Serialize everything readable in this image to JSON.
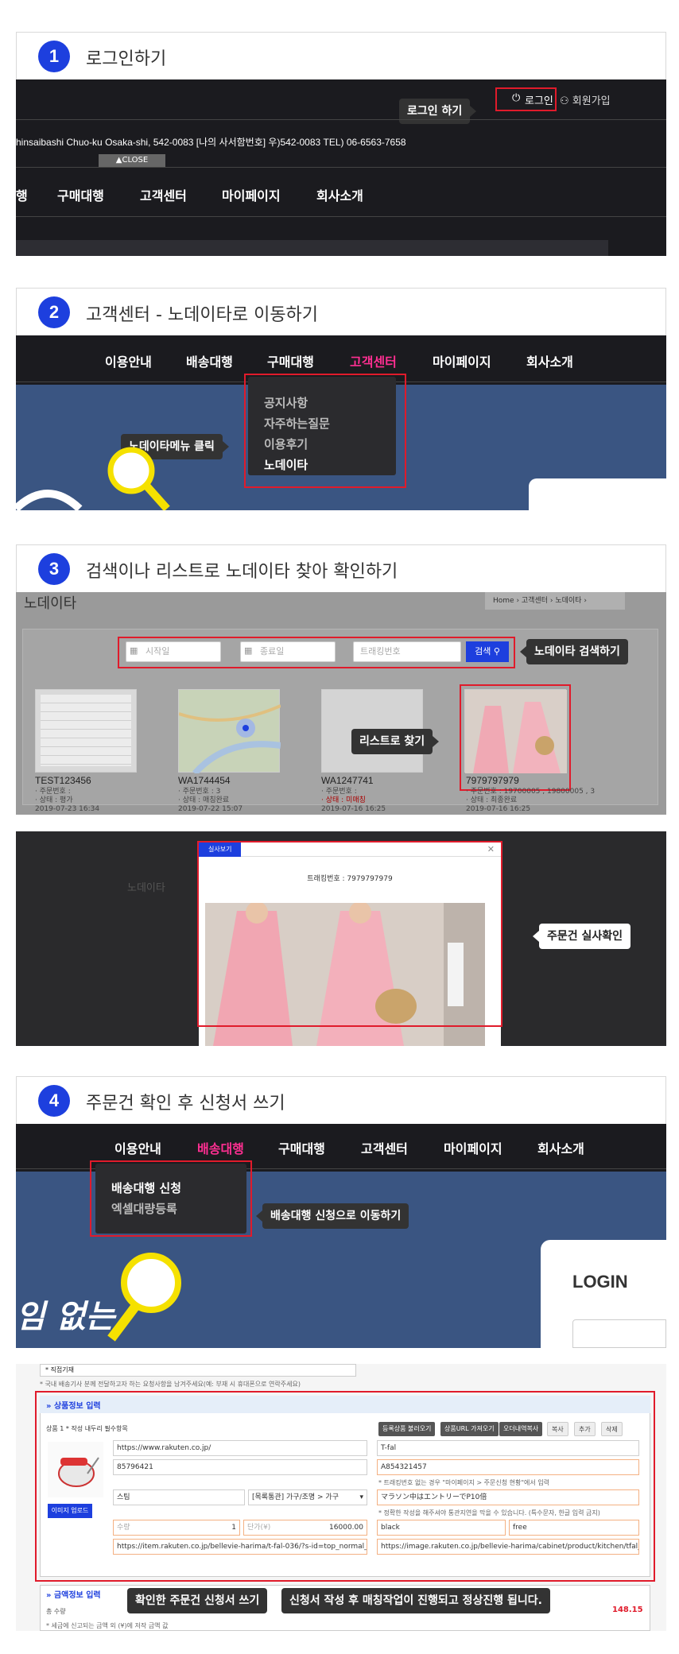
{
  "steps": [
    {
      "num": "1",
      "title": "로그인하기"
    },
    {
      "num": "2",
      "title": "고객센터 - 노데이타로 이동하기"
    },
    {
      "num": "3",
      "title": "검색이나 리스트로 노데이타 찾아 확인하기"
    },
    {
      "num": "4",
      "title": "주문건 확인 후 신청서 쓰기"
    }
  ],
  "step1": {
    "login": "로그인",
    "signup": "회원가입",
    "tip_login": "로그인 하기",
    "address": "hinsaibashi Chuo-ku Osaka-shi,  542-0083  [나의 사서함번호]  우)542-0083  TEL) 06-6563-7658",
    "close": "▲CLOSE",
    "nav": [
      "행",
      "구매대행",
      "고객센터",
      "마이페이지",
      "회사소개"
    ]
  },
  "step2": {
    "nav": [
      "이용안내",
      "배송대행",
      "구매대행",
      "고객센터",
      "마이페이지",
      "회사소개"
    ],
    "dropdown": [
      "공지사항",
      "자주하는질문",
      "이용후기",
      "노데이타"
    ],
    "tip": "노데이타메뉴 클릭"
  },
  "step3": {
    "page_title": "노데이타",
    "breadcrumb": "Home  ›  고객센터  ›  노데이타  ›",
    "start_placeholder": "시작일",
    "end_placeholder": "종료일",
    "tracking_placeholder": "트래킹번호",
    "search_button": "검색",
    "tip_search": "노데이타 검색하기",
    "tip_list": "리스트로 찾기",
    "cards": [
      {
        "id": "TEST123456",
        "order": "· 주문번호 :",
        "status": "· 상태 : 평가",
        "date": "2019-07-23 16:34"
      },
      {
        "id": "WA1744454",
        "order": "· 주문번호 : 3",
        "status": "· 상태 : 매칭완료",
        "date": "2019-07-22 15:07"
      },
      {
        "id": "WA1247741",
        "order": "· 주문번호 :",
        "status": "· 상태 : 미매칭",
        "date": "2019-07-16 16:25"
      },
      {
        "id": "7979797979",
        "order": "· 주문번호 : 19700005 , 19800005 , 3",
        "status": "· 상태 : 최종완료",
        "date": "2019-07-16 16:25"
      }
    ],
    "modal_title": "실사보기",
    "modal_tracking": "트래킹번호 : 7979797979",
    "bg_title": "노데이타",
    "tip_photo": "주문건 실사확인"
  },
  "step4": {
    "nav": [
      "이용안내",
      "배송대행",
      "구매대행",
      "고객센터",
      "마이페이지",
      "회사소개"
    ],
    "dropdown": [
      "배송대행 신청",
      "엑셀대량등록"
    ],
    "tip": "배송대행 신청으로 이동하기",
    "login_box": "LOGIN",
    "banner_text": "임 없는"
  },
  "form": {
    "select_label": "* 직접기재",
    "top_note": "* 국내 배송기사 분께 전달하고자 하는 요청사항을 남겨주세요(예: 부재 시 휴대폰으로 연락주세요)",
    "section_title": "» 상품정보 입력",
    "product_label": "상품 1 * 작성 내두리 필수항목",
    "buttons": [
      "등록상품 불러오기",
      "상품URL 가져오기",
      "오더내역복사",
      "복사",
      "추가",
      "삭제"
    ],
    "url": "https://www.rakuten.co.jp/",
    "brand": "T-fal",
    "order_no": "85796421",
    "tracking": "A854321457",
    "tracking_note": "* 트래킹번호 없는 경우 \"마이페이지 > 주문신청 현황\"에서 입력",
    "category": "스팀",
    "category2": "[목록통관] 가구/조명 > 가구",
    "product_name": "マラソン中はエントリーでP10倍",
    "name_note": "* 정확한 작성을 해주셔야 통관지연을 막을 수 있습니다. (특수문자, 한글 입력 금지)",
    "qty_label": "수량",
    "qty": "1",
    "price_label": "단가(¥)",
    "price": "16000.00",
    "color": "black",
    "size": "free",
    "product_url": "https://item.rakuten.co.jp/bellevie-harima/t-fal-036/?s-id=top_normal_histreco_l",
    "image_url": "https://image.rakuten.co.jp/bellevie-harima/cabinet/product/kitchen/tfal_steam",
    "upload_button": "이미지 업로드",
    "section2_title": "» 금액정보 입력",
    "total_label": "총 수량",
    "total_value": "148.15",
    "bottom_note": "* 세금에 신고되는 금액 외 (¥)에 저작 금액 값",
    "tip_write": "확인한 주문건 신청서 쓰기",
    "tip_done": "신청서 작성 후 매칭작업이 진행되고 정상진행 됩니다."
  },
  "colors": {
    "accent": "#1d3fde",
    "highlight": "#e01b2b",
    "pink": "#ff2f92",
    "dark": "#1b1b1f"
  }
}
